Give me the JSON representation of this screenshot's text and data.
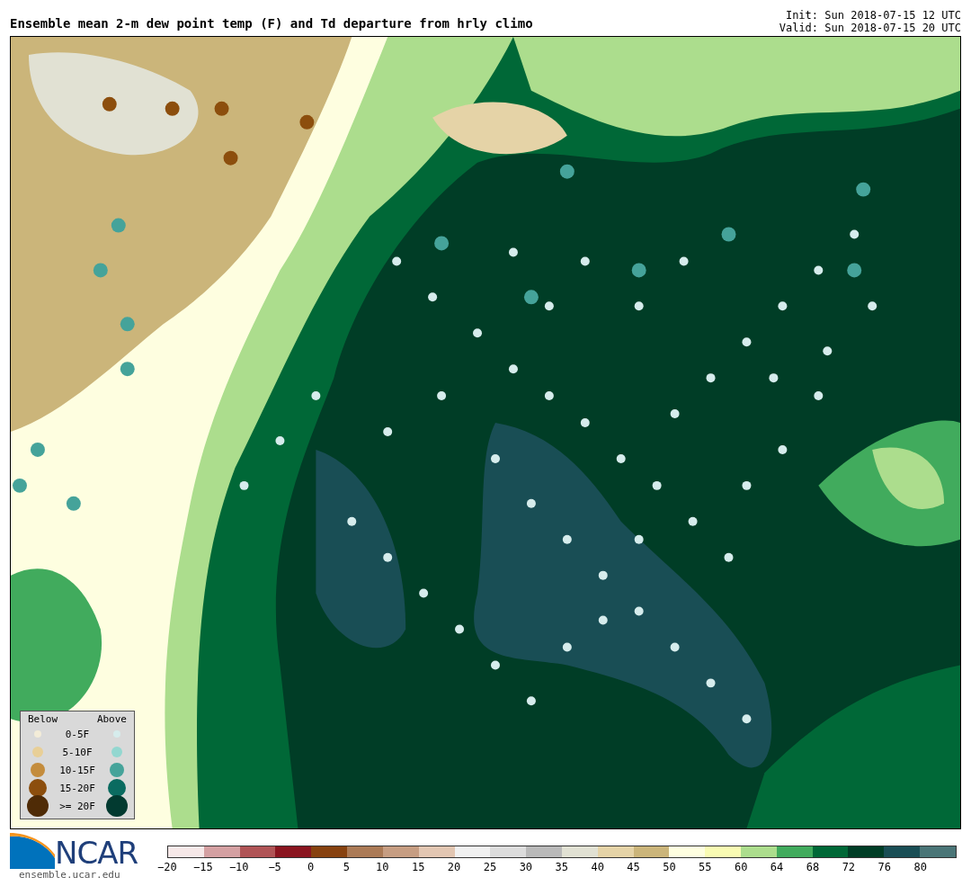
{
  "title": "Ensemble mean 2-m dew point temp (F) and Td departure from hrly climo",
  "init": "Init: Sun 2018-07-15 12 UTC",
  "valid": "Valid: Sun 2018-07-15 20 UTC",
  "legend": {
    "below_heading": "Below",
    "above_heading": "Above",
    "rows": [
      {
        "label": "0-5F",
        "below": {
          "color": "#f3ecd8"
        },
        "above": {
          "color": "#d6ecec"
        }
      },
      {
        "label": "5-10F",
        "below": {
          "color": "#e8cf97"
        },
        "above": {
          "color": "#93d7d0"
        }
      },
      {
        "label": "10-15F",
        "below": {
          "color": "#c48c3c"
        },
        "above": {
          "color": "#45a39a"
        }
      },
      {
        "label": "15-20F",
        "below": {
          "color": "#8c4e0d"
        },
        "above": {
          "color": "#0a6b60"
        }
      },
      {
        "label": ">= 20F",
        "below": {
          "color": "#4f2b06"
        },
        "above": {
          "color": "#023a30"
        }
      }
    ]
  },
  "logo": {
    "name": "NCAR",
    "url": "ensemble.ucar.edu"
  },
  "colorbar": {
    "bins": [
      {
        "color": "#f6e8e8",
        "tick": "−20"
      },
      {
        "color": "#d4a0a2",
        "tick": "−15"
      },
      {
        "color": "#b05456",
        "tick": "−10"
      },
      {
        "color": "#8a1520",
        "tick": "−5"
      },
      {
        "color": "#874210",
        "tick": "0"
      },
      {
        "color": "#ab7a56",
        "tick": "5"
      },
      {
        "color": "#c69d82",
        "tick": "10"
      },
      {
        "color": "#e2c6b2",
        "tick": "15"
      },
      {
        "color": "#f1f1f1",
        "tick": "20"
      },
      {
        "color": "#dcdcdc",
        "tick": "25"
      },
      {
        "color": "#b9b9b9",
        "tick": "30"
      },
      {
        "color": "#e1e1d3",
        "tick": "35"
      },
      {
        "color": "#e5d3a7",
        "tick": "40"
      },
      {
        "color": "#cbb57a",
        "tick": "45"
      },
      {
        "color": "#fefee0",
        "tick": "50"
      },
      {
        "color": "#f9fbb3",
        "tick": "55"
      },
      {
        "color": "#acdd8d",
        "tick": "60"
      },
      {
        "color": "#41ab5d",
        "tick": "64"
      },
      {
        "color": "#006837",
        "tick": "68"
      },
      {
        "color": "#003d26",
        "tick": "72"
      },
      {
        "color": "#194e55",
        "tick": "76"
      },
      {
        "color": "#4a7577",
        "tick": "80"
      }
    ]
  }
}
